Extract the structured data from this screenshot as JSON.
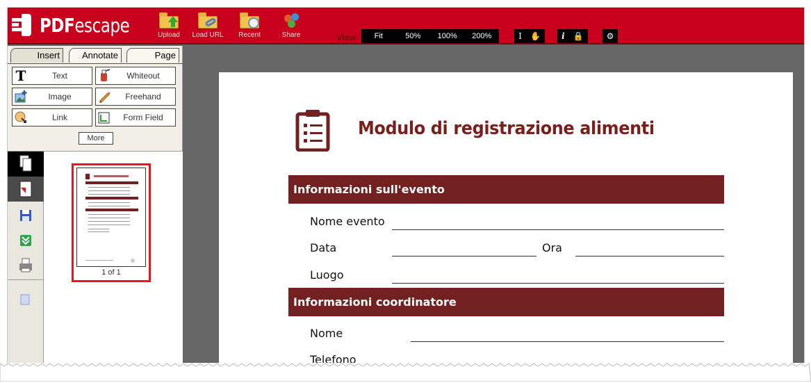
{
  "app": {
    "name_prefix": "PDF",
    "name_suffix": "escape"
  },
  "toolbar": {
    "upload_label": "Upload",
    "load_url_label": "Load URL",
    "recent_label": "Recent",
    "share_label": "Share",
    "view_label": "View:",
    "zoom_options": [
      "Fit",
      "50%",
      "100%",
      "200%"
    ]
  },
  "tabs": {
    "insert": "Insert",
    "annotate": "Annotate",
    "page": "Page"
  },
  "tools": {
    "text": "Text",
    "whiteout": "Whiteout",
    "image": "Image",
    "freehand": "Freehand",
    "link": "Link",
    "form_field": "Form Field",
    "more": "More"
  },
  "thumbnail": {
    "page_label": "1 of 1"
  },
  "document": {
    "title": "Modulo di registrazione alimenti",
    "section_event": "Informazioni sull'evento",
    "event_name": "Nome evento",
    "date": "Data",
    "time": "Ora",
    "place": "Luogo",
    "section_coordinator": "Informazioni coordinatore",
    "name": "Nome",
    "phone": "Telefono"
  },
  "colors": {
    "brand_red": "#c8001b",
    "doc_maroon": "#722020",
    "thumb_highlight": "#e8141e"
  }
}
